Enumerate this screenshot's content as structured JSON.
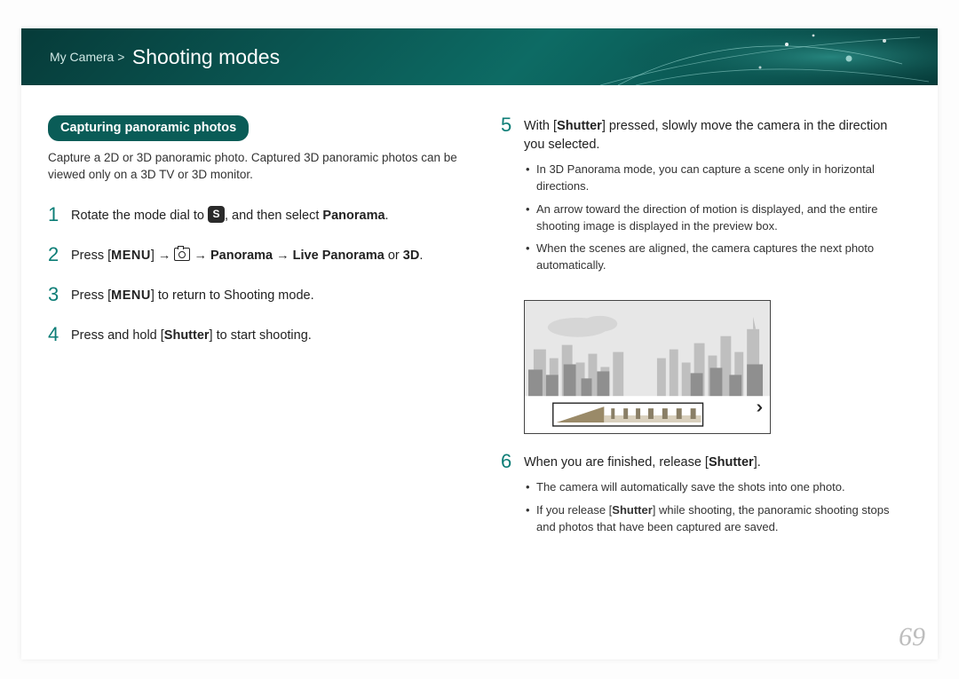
{
  "header": {
    "breadcrumb_prefix": "My Camera >",
    "title": "Shooting modes"
  },
  "section": {
    "pill": "Capturing panoramic photos",
    "intro": "Capture a 2D or 3D panoramic photo. Captured 3D panoramic photos can be viewed only on a 3D TV or 3D monitor."
  },
  "steps": {
    "s1_num": "1",
    "s1_a": "Rotate the mode dial to ",
    "s1_b": ", and then select ",
    "s1_c": "Panorama",
    "s1_d": ".",
    "s_badge": "S",
    "s2_num": "2",
    "s2_a": "Press [",
    "s2_menu": "MENU",
    "s2_b": "] → ",
    "s2_c": " → ",
    "s2_pan": "Panorama",
    "s2_d": " → ",
    "s2_live": "Live Panorama",
    "s2_e": " or ",
    "s2_3d": "3D",
    "s2_f": ".",
    "s3_num": "3",
    "s3_a": "Press [",
    "s3_menu": "MENU",
    "s3_b": "] to return to Shooting mode.",
    "s4_num": "4",
    "s4_a": "Press and hold [",
    "s4_s": "Shutter",
    "s4_b": "] to start shooting.",
    "s5_num": "5",
    "s5_a": "With [",
    "s5_s": "Shutter",
    "s5_b": "] pressed, slowly move the camera in the direction you selected.",
    "s5_bullets": {
      "b1": "In 3D Panorama mode, you can capture a scene only in horizontal directions.",
      "b2": "An arrow toward the direction of motion is displayed, and the entire shooting image is displayed in the preview box.",
      "b3": "When the scenes are aligned, the camera captures the next photo automatically."
    },
    "s6_num": "6",
    "s6_a": "When you are finished, release [",
    "s6_s": "Shutter",
    "s6_b": "].",
    "s6_bullets": {
      "b1": "The camera will automatically save the shots into one photo.",
      "b2_a": "If you release [",
      "b2_s": "Shutter",
      "b2_b": "] while shooting, the panoramic shooting stops and photos that have been captured are saved."
    }
  },
  "page_number": "69"
}
